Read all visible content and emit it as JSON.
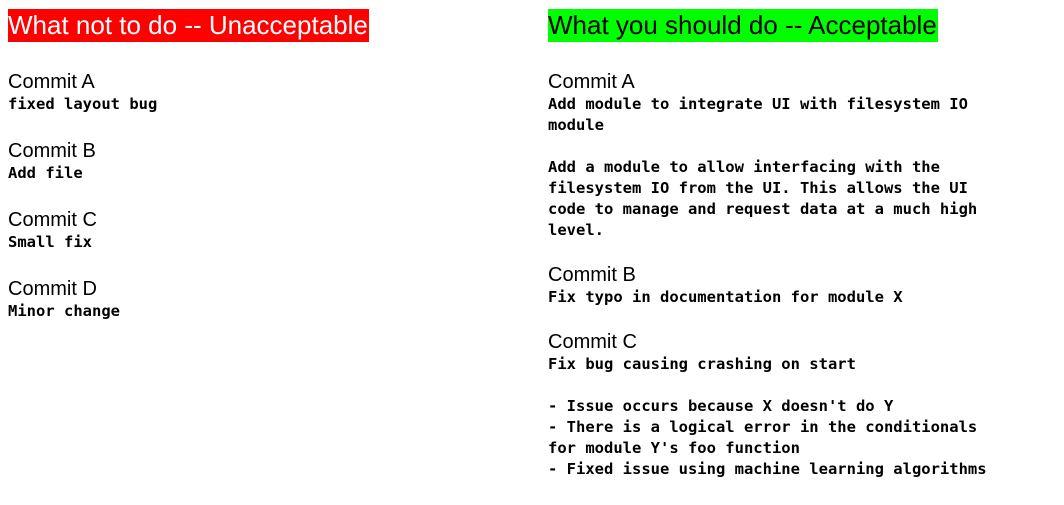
{
  "unacceptable": {
    "heading": "What not to do -- Unacceptable",
    "commits": [
      {
        "title": "Commit A",
        "message": "fixed layout bug"
      },
      {
        "title": "Commit B",
        "message": "Add file"
      },
      {
        "title": "Commit C",
        "message": "Small fix"
      },
      {
        "title": "Commit D",
        "message": "Minor change"
      }
    ]
  },
  "acceptable": {
    "heading": "What you should do -- Acceptable",
    "commits": [
      {
        "title": "Commit A",
        "message": "Add module to integrate UI with filesystem IO\nmodule",
        "body": "Add a module to allow interfacing with the\nfilesystem IO from the UI. This allows the UI\ncode to manage and request data at a much high\nlevel."
      },
      {
        "title": "Commit B",
        "message": "Fix typo in documentation for module X"
      },
      {
        "title": "Commit C",
        "message": "Fix bug causing crashing on start",
        "body": "- Issue occurs because X doesn't do Y\n- There is a logical error in the conditionals\nfor module Y's foo function\n- Fixed issue using machine learning algorithms"
      }
    ]
  },
  "colors": {
    "unacceptable_banner": "#ff0000",
    "acceptable_banner": "#00ff00"
  }
}
